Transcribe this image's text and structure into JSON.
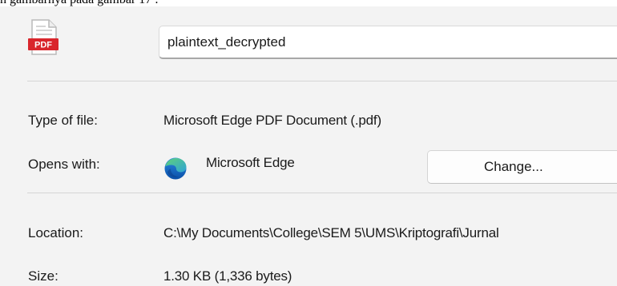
{
  "context": {
    "caption_text": "h gambarnya pada gambar 17 :"
  },
  "file": {
    "icon": "pdf-file-icon",
    "icon_badge": "PDF",
    "name_value": "plaintext_decrypted"
  },
  "details": {
    "type_label": "Type of file:",
    "type_value": "Microsoft Edge PDF Document (.pdf)",
    "opens_label": "Opens with:",
    "opens_app_icon": "microsoft-edge-icon",
    "opens_app_name": "Microsoft Edge",
    "change_button_label": "Change...",
    "location_label": "Location:",
    "location_value": "C:\\My Documents\\College\\SEM 5\\UMS\\Kriptografi\\Jurnal",
    "size_label": "Size:",
    "size_value": "1.30 KB (1,336 bytes)"
  },
  "colors": {
    "pdf_red": "#d9262c",
    "edge_blue": "#1a72c9",
    "edge_green": "#46c25f",
    "dialog_background": "#f3f3f3"
  }
}
